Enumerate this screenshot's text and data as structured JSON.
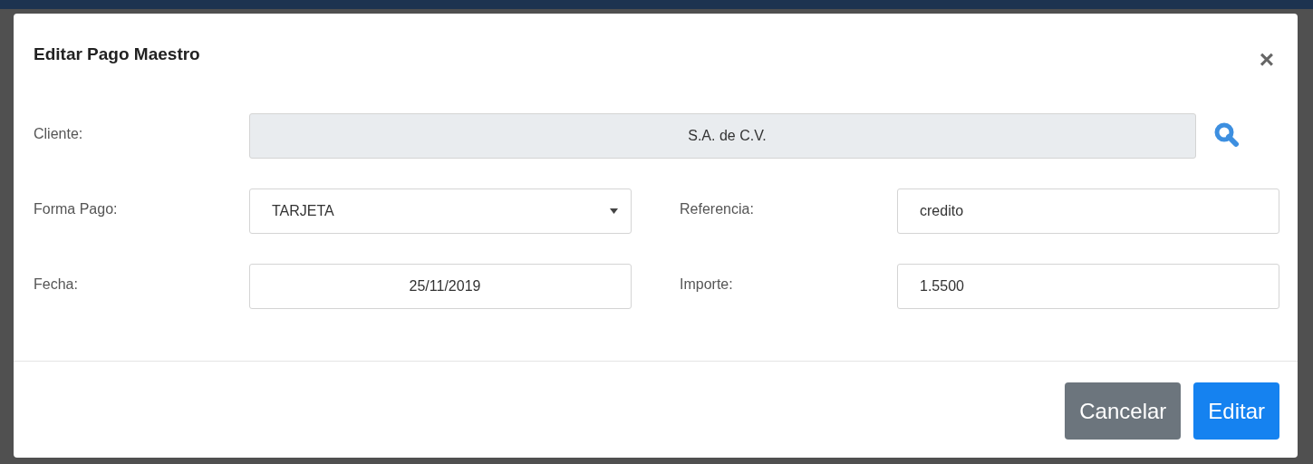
{
  "modal": {
    "title": "Editar Pago Maestro",
    "close": "×"
  },
  "cliente": {
    "label": "Cliente:",
    "kind": "lookup",
    "value": "S.A. de C.V.",
    "disabled": true
  },
  "fields": [
    {
      "label": "Forma Pago:",
      "kind": "select",
      "value": "TARJETA"
    },
    {
      "label": "Referencia:",
      "kind": "input",
      "value": "credito"
    },
    {
      "label": "Fecha:",
      "kind": "date",
      "value": "25/11/2019"
    },
    {
      "label": "Importe:",
      "kind": "input",
      "value": "1.5500"
    }
  ],
  "buttons": [
    {
      "label": "Cancelar",
      "kind": "secondary"
    },
    {
      "label": "Editar",
      "kind": "primary"
    }
  ]
}
